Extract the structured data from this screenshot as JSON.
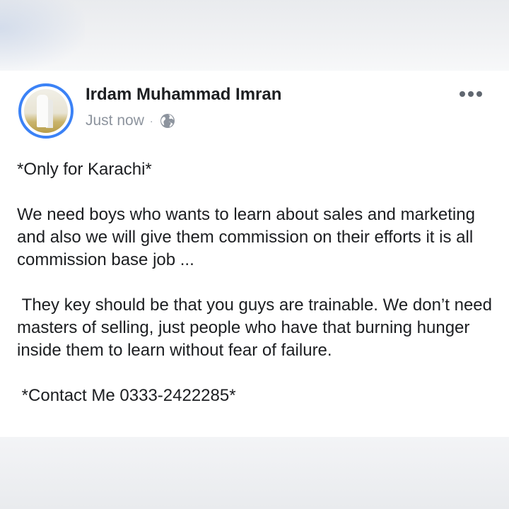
{
  "post": {
    "author": "Irdam Muhammad Imran",
    "timestamp": "Just now",
    "separator": "·",
    "privacy_icon": "globe-icon",
    "more_icon": "more-options-icon",
    "avatar_ring_color": "#3b82f6",
    "paragraphs": [
      "*Only for Karachi*",
      "We need boys who wants to learn about sales and marketing and also we will give them commission on their efforts it is all commission base job ...",
      " They key should be that you guys are trainable. We don’t need masters of selling, just people who have that burning hunger inside them to learn without fear of failure.",
      " *Contact Me 0333-2422285*"
    ]
  }
}
